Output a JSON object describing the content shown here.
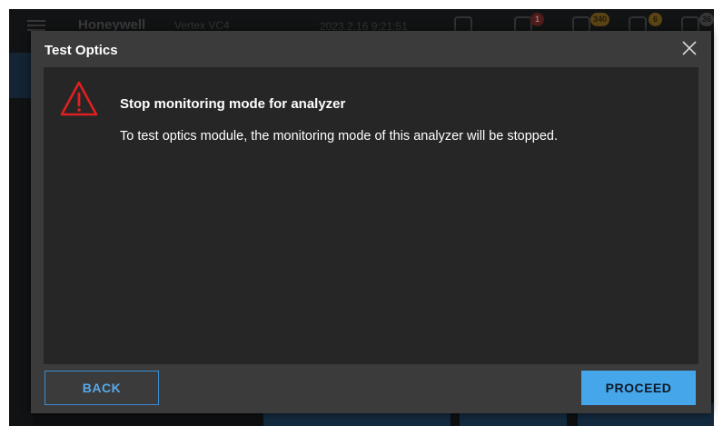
{
  "app": {
    "brand": "Honeywell",
    "product": "Vertex VC4",
    "datetime": "2023.2.16 9:21:51",
    "badges": {
      "alarms": "1",
      "warnings": "340",
      "maintenance": "6",
      "list": "36"
    }
  },
  "dialog": {
    "title": "Test Optics",
    "close_icon": "close-icon",
    "warning_icon": "warning-triangle-icon",
    "message_title": "Stop monitoring mode for analyzer",
    "message_text": "To test optics module, the monitoring mode of this analyzer will be stopped.",
    "back_label": "BACK",
    "proceed_label": "PROCEED"
  },
  "colors": {
    "accent": "#45a6ea",
    "warning": "#e02020",
    "dialog_bg": "#3b3b3c",
    "body_bg": "#262626"
  }
}
